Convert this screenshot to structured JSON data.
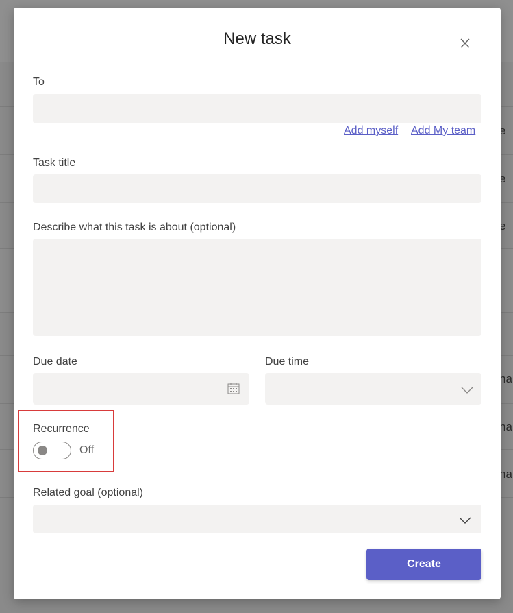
{
  "background": {
    "row_fragments": [
      "e",
      "e",
      "e",
      "na",
      "na",
      "na"
    ]
  },
  "dialog": {
    "title": "New task",
    "close_icon": "close-icon",
    "to": {
      "label": "To",
      "value": "",
      "add_myself": "Add myself",
      "add_my_team": "Add My team"
    },
    "task_title": {
      "label": "Task title",
      "value": ""
    },
    "description": {
      "label": "Describe what this task is about (optional)",
      "value": ""
    },
    "due_date": {
      "label": "Due date",
      "value": "",
      "icon": "calendar-icon"
    },
    "due_time": {
      "label": "Due time",
      "value": "",
      "icon": "chevron-down-icon"
    },
    "recurrence": {
      "label": "Recurrence",
      "state": "Off"
    },
    "related_goal": {
      "label": "Related goal (optional)",
      "value": "",
      "icon": "chevron-down-icon"
    },
    "create_label": "Create"
  },
  "colors": {
    "accent": "#5b5fc7",
    "field_bg": "#f3f2f1",
    "highlight": "#d83b3b"
  }
}
